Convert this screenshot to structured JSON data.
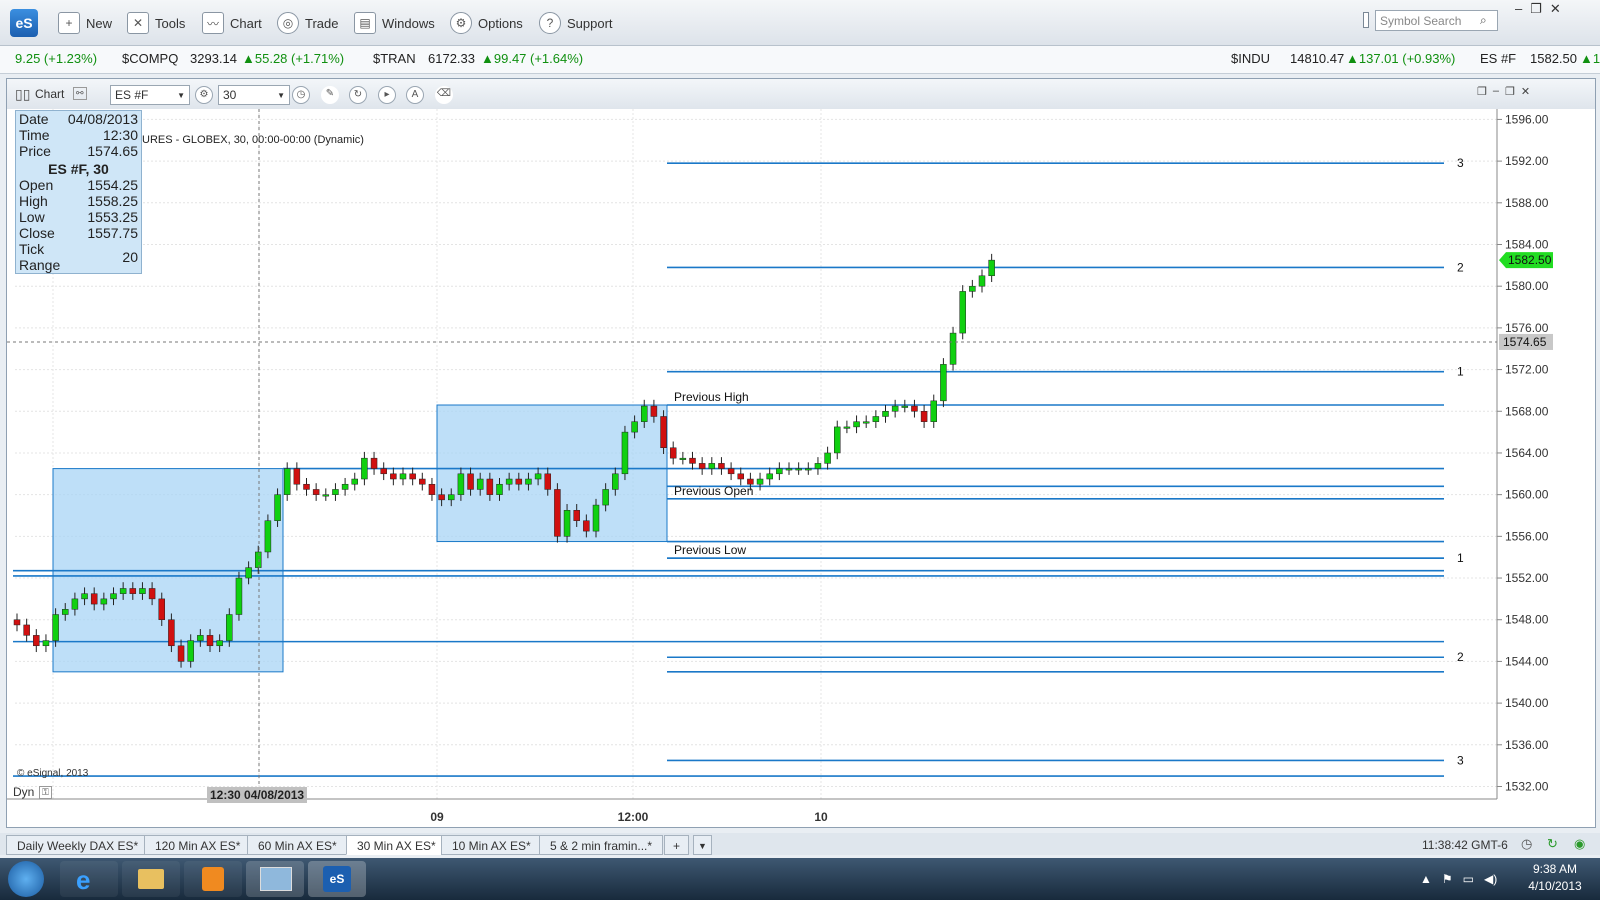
{
  "app": {
    "logo": "eS",
    "toolbar": [
      "New",
      "Tools",
      "Chart",
      "Trade",
      "Windows",
      "Options",
      "Support"
    ],
    "symbol_search_placeholder": "Symbol Search"
  },
  "ticker": [
    {
      "name": "",
      "price": "",
      "change": "9.25 (+1.23%)"
    },
    {
      "name": "$COMPQ",
      "price": "3293.14",
      "change": "▲55.28 (+1.71%)"
    },
    {
      "name": "$TRAN",
      "price": "6172.33",
      "change": "▲99.47 (+1.64%)"
    },
    {
      "name": "$INDU",
      "price": "14810.47",
      "change": "▲137.01 (+0.93%)"
    },
    {
      "name": "ES #F",
      "price": "1582.50",
      "change": "▲1"
    }
  ],
  "chart_window": {
    "title": "Chart",
    "symbol": "ES #F",
    "interval": "30",
    "description": "URES - GLOBEX, 30, 00:00-00:00 (Dynamic)",
    "copyright": "© eSignal, 2013",
    "dyn_label": "Dyn",
    "crosshair_time_label": "12:30 04/08/2013"
  },
  "info_box": {
    "rows": [
      {
        "k": "Date",
        "v": "04/08/2013"
      },
      {
        "k": "Time",
        "v": "12:30"
      },
      {
        "k": "Price",
        "v": "1574.65"
      }
    ],
    "header": "ES #F, 30",
    "ohlc": [
      {
        "k": "Open",
        "v": "1554.25"
      },
      {
        "k": "High",
        "v": "1558.25"
      },
      {
        "k": "Low",
        "v": "1553.25"
      },
      {
        "k": "Close",
        "v": "1557.75"
      },
      {
        "k": "Tick Range",
        "v": "20"
      }
    ]
  },
  "chart_data": {
    "type": "candlestick",
    "y_axis": {
      "min": 1530,
      "max": 1597,
      "ticks": [
        1596,
        1592,
        1588,
        1584,
        1580,
        1576,
        1572,
        1568,
        1564,
        1560,
        1556,
        1552,
        1548,
        1544,
        1540,
        1536,
        1532
      ]
    },
    "x_labels": [
      "09",
      "12:00",
      "10"
    ],
    "last_price": "1582.50",
    "crosshair_price": "1574.65",
    "closes": [
      1547.5,
      1546.5,
      1545.5,
      1546,
      1548.5,
      1549,
      1550,
      1550.5,
      1549.5,
      1550,
      1550.5,
      1551,
      1550.5,
      1551,
      1550,
      1548,
      1545.5,
      1544,
      1546,
      1546.5,
      1545.5,
      1546,
      1548.5,
      1552,
      1553,
      1554.5,
      1557.5,
      1560,
      1562.5,
      1561,
      1560.5,
      1560,
      1560,
      1560.5,
      1561,
      1561.5,
      1563.5,
      1562.5,
      1562,
      1561.5,
      1562,
      1561.5,
      1561,
      1560,
      1559.5,
      1560,
      1562,
      1560.5,
      1561.5,
      1560,
      1561,
      1561.5,
      1561,
      1561.5,
      1562,
      1560.5,
      1556,
      1558.5,
      1557.5,
      1556.5,
      1559,
      1560.5,
      1562,
      1566,
      1567,
      1568.5,
      1567.5,
      1564.5,
      1563.5,
      1563.5,
      1563,
      1562.5,
      1563,
      1562.5,
      1562,
      1561.5,
      1561,
      1561.5,
      1562,
      1562.5,
      1562.5,
      1562.5,
      1562.5,
      1563,
      1564,
      1566.5,
      1566.5,
      1567,
      1567,
      1567.5,
      1568,
      1568.5,
      1568.5,
      1568,
      1567,
      1569,
      1572.5,
      1575.5,
      1579.5,
      1580,
      1581,
      1582.5
    ],
    "horizontal_levels": [
      {
        "label": "3",
        "value": 1591.8
      },
      {
        "label": "2",
        "value": 1581.8
      },
      {
        "label": "1",
        "value": 1571.8
      },
      {
        "label": "Previous High",
        "value": 1568.6
      },
      {
        "label": "",
        "value": 1562.5
      },
      {
        "label": "",
        "value": 1560.8
      },
      {
        "label": "Previous Open",
        "value": 1559.6
      },
      {
        "label": "",
        "value": 1555.5
      },
      {
        "label": "1",
        "value": 1553.9
      },
      {
        "label": "Previous Low",
        "value": 1553.9
      },
      {
        "label": "",
        "value": 1552.7
      },
      {
        "label": "",
        "value": 1552.2
      },
      {
        "label": "",
        "value": 1545.9
      },
      {
        "label": "2",
        "value": 1544.4
      },
      {
        "label": "",
        "value": 1543.0
      },
      {
        "label": "3",
        "value": 1534.5
      },
      {
        "label": "",
        "value": 1533.0
      }
    ],
    "range_boxes": [
      {
        "high": 1562.5,
        "low": 1543.0
      },
      {
        "high": 1568.6,
        "low": 1555.5
      }
    ]
  },
  "tabs": [
    "Daily Weekly DAX ES*",
    "120 Min AX ES*",
    "60 Min AX ES*",
    "30 Min AX ES*",
    "10 Min AX ES*",
    "5 & 2 min framin...*"
  ],
  "status_time": "11:38:42 GMT-6",
  "taskbar": {
    "time": "9:38 AM",
    "date": "4/10/2013"
  },
  "colors": {
    "up": "#10d010",
    "down": "#d01010",
    "level": "#1a78c8",
    "box": "#a8d4f5"
  }
}
